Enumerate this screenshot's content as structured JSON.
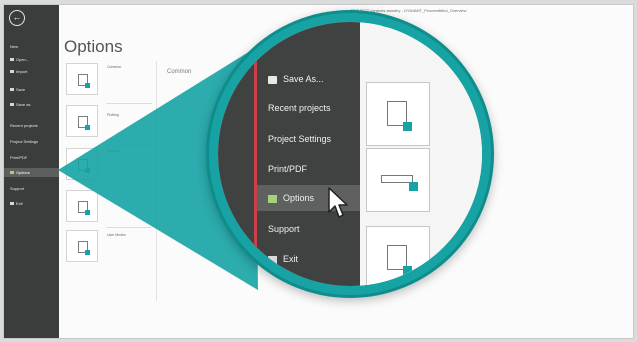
{
  "window": {
    "title": "PROJECT contents standby - DYNAMIT_Proceedtitled_Overview"
  },
  "sidebar": {
    "back_glyph": "←",
    "items": [
      {
        "label": "New",
        "icon": ""
      },
      {
        "label": "Open...",
        "icon": "folder-icon"
      },
      {
        "label": "Import",
        "icon": "import-icon"
      },
      {
        "label": "Save",
        "icon": "save-icon"
      },
      {
        "label": "Save as",
        "icon": "save-as-icon"
      },
      {
        "label": "Recent projects",
        "icon": ""
      },
      {
        "label": "Project Settings",
        "icon": ""
      },
      {
        "label": "Print/PDF",
        "icon": ""
      },
      {
        "label": "Options",
        "icon": "options-icon",
        "active": true
      },
      {
        "label": "Support",
        "icon": ""
      },
      {
        "label": "Exit",
        "icon": "exit-icon"
      }
    ]
  },
  "main": {
    "title": "Options",
    "sub_heading": "Common",
    "categories": [
      {
        "label": "Common"
      },
      {
        "label": "Plotting"
      },
      {
        "label": "Defaults"
      },
      {
        "label": ""
      },
      {
        "label": "User Modes"
      }
    ]
  },
  "lens": {
    "menu": [
      {
        "label": "Save As...",
        "icon": "save-icon"
      },
      {
        "label": "Recent projects",
        "icon": ""
      },
      {
        "label": "Project Settings",
        "icon": ""
      },
      {
        "label": "Print/PDF",
        "icon": ""
      },
      {
        "label": "Options",
        "icon": "options-icon",
        "active": true
      },
      {
        "label": "Support",
        "icon": ""
      },
      {
        "label": "Exit",
        "icon": "exit-icon"
      }
    ]
  },
  "colors": {
    "accent": "#17a3a3",
    "sidebar": "#3a3d3c",
    "red_bar": "#c9404a",
    "option_icon": "#a6d07b"
  }
}
